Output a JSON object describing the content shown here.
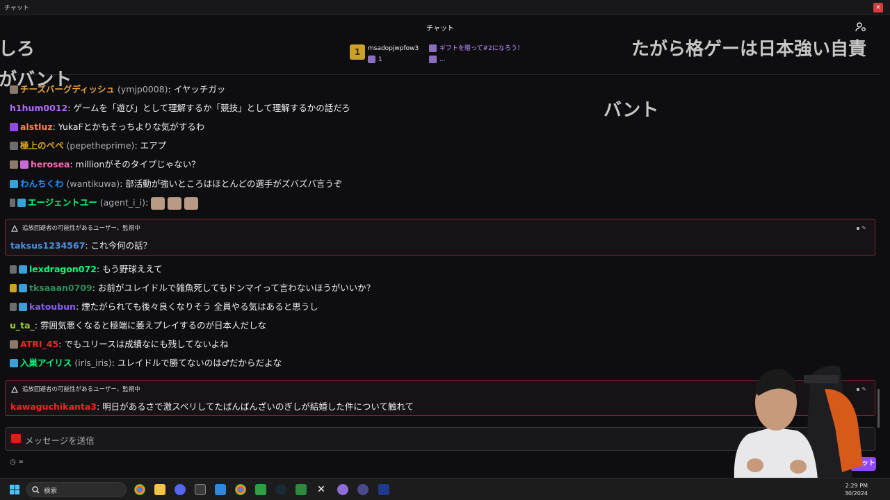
{
  "window": {
    "title": "チャット",
    "close_glyph": "×"
  },
  "header": {
    "title": "チャット",
    "users_icon": "users-gear-icon"
  },
  "overlay_text": [
    "しろ",
    "がバント",
    "たがら格ゲーは日本強い自責",
    "バント"
  ],
  "gift": {
    "user": "msadopjwpfow3",
    "count": "1",
    "cta": "ギフトを贈って#2になろう！",
    "more": "..."
  },
  "messages": [
    {
      "name": "チーズバーグディッシュ",
      "alt": "(ymjp0008)",
      "text": ": イヤッチガッ",
      "color": "#e6a23c"
    },
    {
      "name": "h1hum0012",
      "alt": "",
      "text": ": ゲームを「遊び」として理解するか「競技」として理解するかの話だろ",
      "color": "#b26bff"
    },
    {
      "name": "alstluz",
      "alt": "",
      "text": ": YukaFとかもそっちよりな気がするわ",
      "color": "#ff7f50"
    },
    {
      "name": "極上のペペ",
      "alt": "(pepetheprime)",
      "text": ": エアプ",
      "color": "#daa520"
    },
    {
      "name": "herosea",
      "alt": "",
      "text": ": millionがそのタイプじゃない？",
      "color": "#ff69b4"
    },
    {
      "name": "わんちくわ",
      "alt": "(wantikuwa)",
      "text": ": 部活動が強いところはほとんどの選手がズバズバ言うぞ",
      "color": "#1e90ff"
    },
    {
      "name": "エージェントユー",
      "alt": "(agent_i_i)",
      "text": ":",
      "color": "#00ff7f"
    }
  ],
  "warn1": {
    "label": "追放回避者の可能性があるユーザー、監視中",
    "name": "taksus1234567",
    "text": ": これ今何の話？",
    "color": "#4a90e2"
  },
  "messages2": [
    {
      "name": "lexdragon072",
      "alt": "",
      "text": ": もう野球ええて",
      "color": "#00ff7f"
    },
    {
      "name": "tksaaan0709",
      "alt": "",
      "text": ": お前がユレイドルで雑魚死してもドンマイって言わないほうがいいか？",
      "color": "#2e8b57"
    },
    {
      "name": "katoubun",
      "alt": "",
      "text": ": 煙たがられても後々良くなりそう 全員やる気はあると思うし",
      "color": "#8a5cf6"
    },
    {
      "name": "u_ta_",
      "alt": "",
      "text": ": 雰囲気悪くなると極端に萎えプレイするのが日本人だしな",
      "color": "#9acd32"
    },
    {
      "name": "ATRI_45",
      "alt": "",
      "text": ": でもユリースは成績なにも残してないよね",
      "color": "#ff2020"
    },
    {
      "name": "入巣アイリス",
      "alt": "(irls_iris)",
      "text": ": ユレイドルで勝てないのは♂だからだよな",
      "color": "#00ff7f"
    }
  ],
  "warn2": {
    "label": "追放回避者の可能性があるユーザー、監視中",
    "name": "kawaguchikanta3",
    "text": ": 明日があるさで激スベリしてたばんばんざいのぎしが結婚した件について触れて",
    "color": "#ff2020"
  },
  "input": {
    "placeholder": "メッセージを送信"
  },
  "points": {
    "value": "∞"
  },
  "chat_button": {
    "label": "チャット"
  },
  "taskbar": {
    "search_label": "検索",
    "time": "2:29 PM",
    "date": "30/2024"
  },
  "colors": {
    "accent": "#9147ff",
    "warn_border": "#7a2b33",
    "background": "#0e0e10"
  }
}
